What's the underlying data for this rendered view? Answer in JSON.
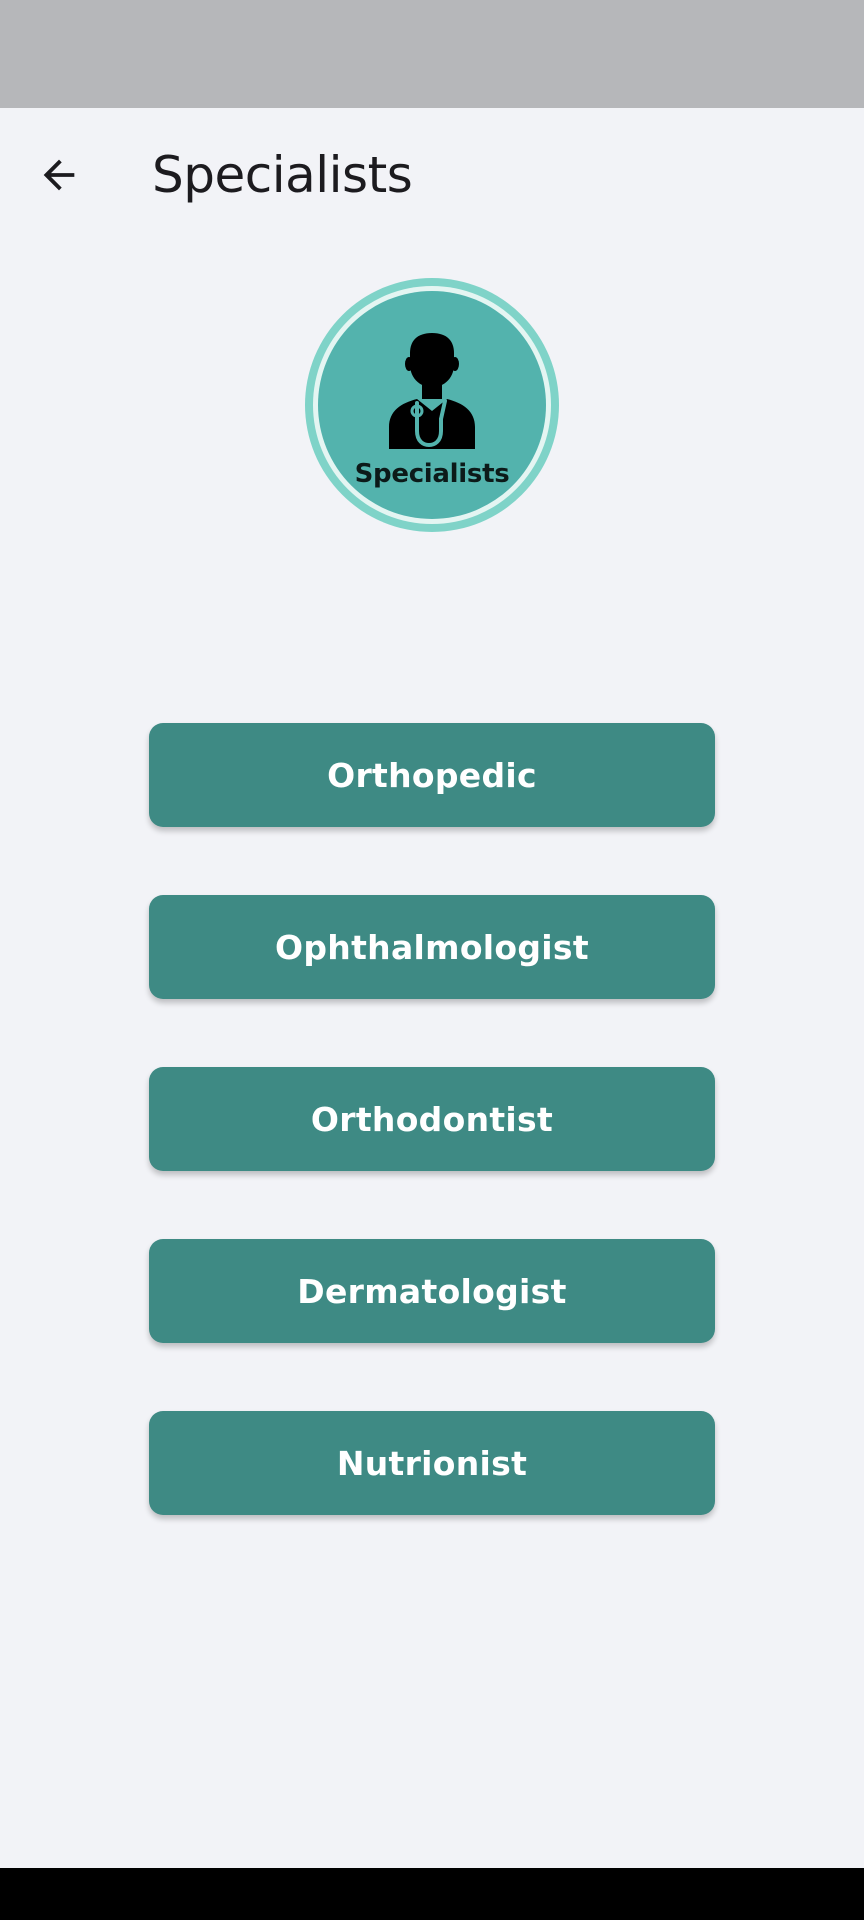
{
  "app_bar": {
    "title": "Specialists",
    "back_icon": "arrow-left-icon"
  },
  "emblem": {
    "label": "Specialists",
    "icon": "doctor-stethoscope-icon"
  },
  "specialties": [
    {
      "label": "Orthopedic"
    },
    {
      "label": "Ophthalmologist"
    },
    {
      "label": "Orthodontist"
    },
    {
      "label": "Dermatologist"
    },
    {
      "label": "Nutrionist"
    }
  ],
  "colors": {
    "background": "#f2f3f7",
    "status_bar": "#b6b7ba",
    "button": "#3e8a84",
    "emblem_fill": "#53b3ad",
    "emblem_ring": "#7fd3c8"
  }
}
